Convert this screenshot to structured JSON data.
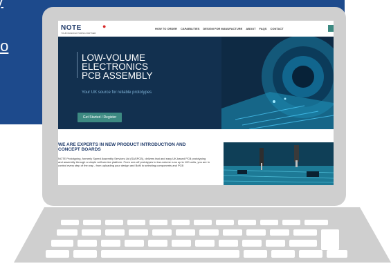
{
  "slide": {
    "text_fragment_top": "y",
    "text_fragment_link": "to",
    "background": "#1d4a8c"
  },
  "website": {
    "logo": "NOTE",
    "logo_tagline": "YOUR MANUFACTURING PARTNER",
    "nav": [
      "HOW TO ORDER",
      "CAPABILITIES",
      "DESIGN FOR MANUFACTURE",
      "ABOUT",
      "FAQS",
      "CONTACT"
    ],
    "hero": {
      "title_lines": [
        "LOW-VOLUME",
        "ELECTRONICS",
        "PCB ASSEMBLY"
      ],
      "subtitle": "Your UK source for reliable prototypes",
      "cta": "Get Started / Register"
    },
    "section": {
      "title": "WE ARE EXPERTS IN NEW PRODUCT INTRODUCTION AND CONCEPT BOARDS",
      "body": "NOTE Prototyping, formerly Speed Assembly Services Ltd (SASPCB), delivers fast and easy UK-based PCB prototyping and assembly through a simple self-service platform. From one-off prototypes to low-volume runs up to 100 units, you are in control every step of the way - from uploading your design and BoM to selecting components and PCB"
    }
  },
  "colors": {
    "brand_navy": "#1d3868",
    "accent_teal": "#3d8a82",
    "hero_bg": "#12304f",
    "logo_dot": "#d62828"
  }
}
